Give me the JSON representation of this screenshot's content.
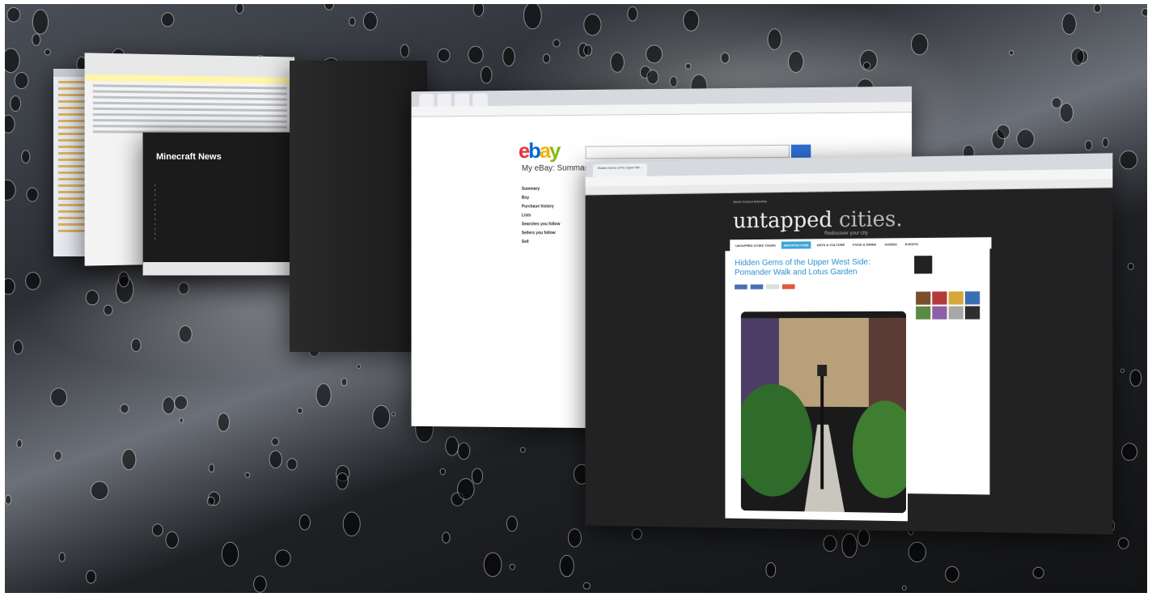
{
  "desktop": {
    "background": "rain-drops-on-glass"
  },
  "windows": {
    "minecraft": {
      "heading": "Minecraft News"
    },
    "ebay": {
      "logo_letters": [
        "e",
        "b",
        "a",
        "y"
      ],
      "page_title": "My eBay: Summary",
      "sidebar": [
        "Summary",
        "Buy",
        "Purchase history",
        "Lists",
        "Searches you follow",
        "Sellers you follow",
        "Sell"
      ]
    },
    "untapped": {
      "tab_title": "Hidden Gems of the Upper We...",
      "top_nav": "About  Contact  Advertise",
      "brand_main": "untapped",
      "brand_secondary": "cities.",
      "tagline": "Rediscover your city",
      "nav": [
        "UNTAPPED CITIES TOURS",
        "ARCHITECTURE",
        "ARTS & CULTURE",
        "FOOD & DRINK",
        "GUIDES",
        "EVENTS"
      ],
      "active_nav_index": 1,
      "article_title": "Hidden Gems of the Upper West Side: Pomander Walk and Lotus Garden"
    }
  },
  "colors": {
    "ebay_red": "#e53238",
    "ebay_blue": "#0064d2",
    "ebay_yellow": "#f5af02",
    "ebay_green": "#86b817",
    "accent_blue": "#2a8fcf",
    "nav_active": "#3aa6d8"
  }
}
